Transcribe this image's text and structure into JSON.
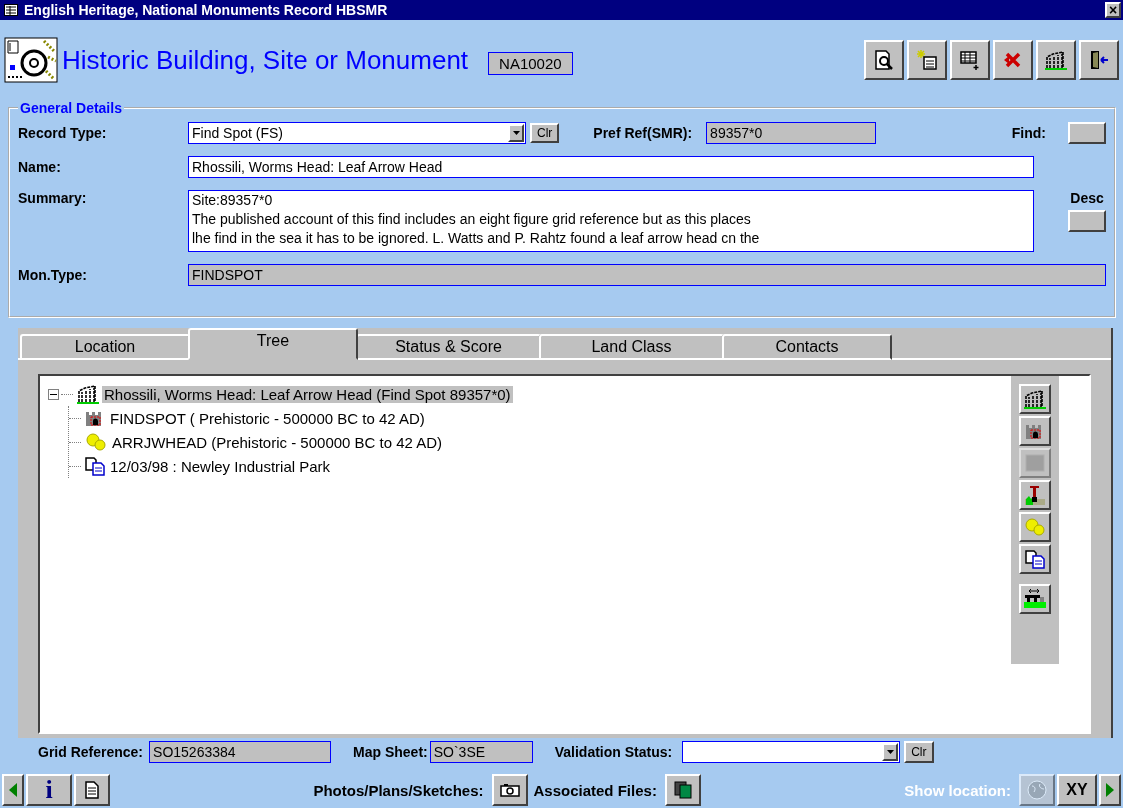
{
  "window": {
    "title": "English Heritage, National Monuments Record HBSMR",
    "close": "×"
  },
  "header": {
    "title": "Historic Building, Site or Monument",
    "record_id": "NA10020"
  },
  "general_details": {
    "legend": "General Details",
    "record_type": {
      "label": "Record Type:",
      "value": "Find Spot (FS)",
      "clear": "Clr"
    },
    "pref_ref": {
      "label": "Pref Ref(SMR):",
      "value": "89357*0"
    },
    "find": {
      "label": "Find:"
    },
    "name": {
      "label": "Name:",
      "value": "Rhossili, Worms Head:  Leaf Arrow Head"
    },
    "summary": {
      "label": "Summary:",
      "lines": [
        "Site:89357*0",
        "The published account of this find includes an eight figure grid reference but as this places",
        "lhe find in the sea it has to be ignored.  L. Watts and P. Rahtz found a leaf arrow head cn the"
      ]
    },
    "desc": {
      "label": "Desc"
    },
    "mon_type": {
      "label": "Mon.Type:",
      "value": "FINDSPOT"
    }
  },
  "tabs": [
    {
      "label": "Location",
      "selected": false
    },
    {
      "label": "Tree",
      "selected": true
    },
    {
      "label": "Status & Score",
      "selected": false
    },
    {
      "label": "Land Class",
      "selected": false
    },
    {
      "label": "Contacts",
      "selected": false
    }
  ],
  "tree": {
    "label": "Rhossili, Worms Head:  Leaf Arrow Head (Find Spot 89357*0)",
    "kind": "monument",
    "expanded": true,
    "selected": true,
    "children": [
      {
        "label": "FINDSPOT ( Prehistoric - 500000 BC to 42 AD)",
        "kind": "monument-type",
        "selected": false
      },
      {
        "label": "ARRJWHEAD (Prehistoric - 500000 BC to 42 AD)",
        "kind": "object",
        "selected": false
      },
      {
        "label": "12/03/98 : Newley Industrial Park",
        "kind": "event",
        "selected": false
      }
    ]
  },
  "side_tools": [
    {
      "kind": "monument",
      "disabled": false
    },
    {
      "kind": "monument-type",
      "disabled": false
    },
    {
      "kind": "blank",
      "disabled": true
    },
    {
      "kind": "excavation",
      "disabled": false
    },
    {
      "kind": "object",
      "disabled": false
    },
    {
      "kind": "event",
      "disabled": false
    },
    {
      "kind": "link",
      "disabled": false
    }
  ],
  "fields": {
    "grid_reference": {
      "label": "Grid Reference:",
      "value": "SO15263384"
    },
    "map_sheet": {
      "label": "Map Sheet:",
      "value": "SO`3SE"
    },
    "validation_status": {
      "label": "Validation Status:",
      "clear": "Clr"
    }
  },
  "toolbar": {
    "info": "i",
    "photos_label": "Photos/Plans/Sketches:",
    "files_label": "Associated Files:",
    "show_location": {
      "label": "Show location:",
      "disabled": true
    },
    "xy": "XY"
  }
}
